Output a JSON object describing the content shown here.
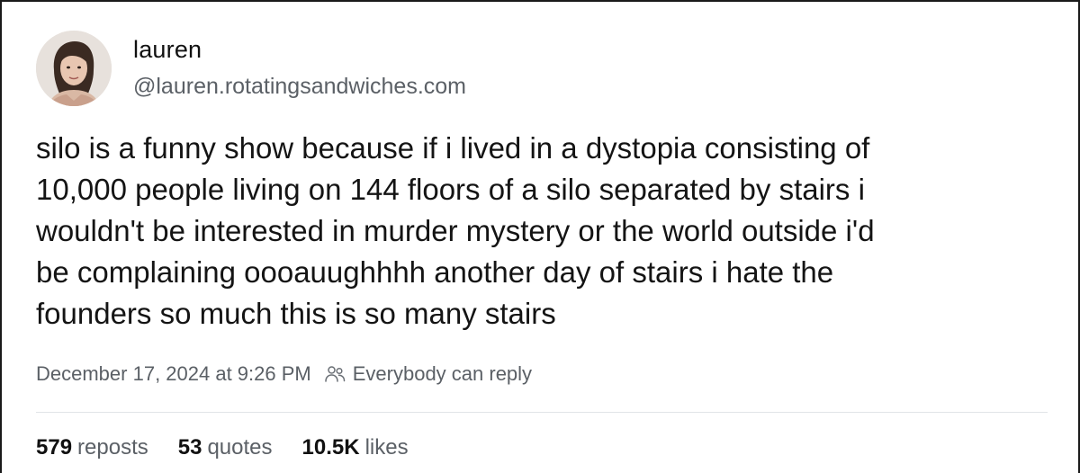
{
  "author": {
    "display_name": "lauren",
    "handle": "@lauren.rotatingsandwiches.com",
    "avatar_icon": "avatar-photo"
  },
  "post": {
    "lines": [
      "silo is a funny show because if i lived in a dystopia consisting of",
      "10,000 people living on 144 floors of a silo separated by stairs i",
      "wouldn't be interested in murder mystery or the world outside i'd",
      "be complaining oooauughhhh another day of stairs i hate the",
      "founders so much this is so many stairs"
    ],
    "timestamp": "December 17, 2024 at 9:26 PM",
    "reply_setting": "Everybody can reply",
    "reply_icon": "people-icon"
  },
  "stats": {
    "reposts_count": "579",
    "reposts_label": "reposts",
    "quotes_count": "53",
    "quotes_label": "quotes",
    "likes_count": "10.5K",
    "likes_label": "likes"
  },
  "colors": {
    "text_primary": "#141414",
    "text_secondary": "#5b6066",
    "divider": "#e1e4e8"
  }
}
